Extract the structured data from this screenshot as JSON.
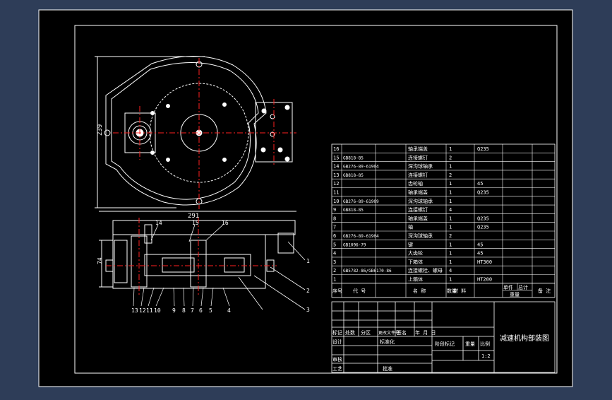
{
  "drawing": {
    "title": "减速机构部装图",
    "scale_value": "1:2",
    "dimensions": {
      "width_label": "291",
      "height_label": "239",
      "section_height_label": "74"
    },
    "balloons_right": [
      "1",
      "2",
      "3"
    ],
    "balloons_section_top": [
      "14",
      "15",
      "16"
    ],
    "balloons_section_bottom": [
      "13",
      "12",
      "11",
      "10",
      "9",
      "8",
      "7",
      "6",
      "5",
      "4"
    ]
  },
  "bom": {
    "rows": [
      {
        "no": "16",
        "code": "",
        "name": "轴承端盖",
        "qty": "1",
        "material": "Q235"
      },
      {
        "no": "15",
        "code": "GB818-85",
        "name": "连接螺钉",
        "qty": "2",
        "material": ""
      },
      {
        "no": "14",
        "code": "GB276-89-61904",
        "name": "深沟球轴承",
        "qty": "1",
        "material": ""
      },
      {
        "no": "13",
        "code": "GB818-85",
        "name": "连接螺钉",
        "qty": "2",
        "material": ""
      },
      {
        "no": "12",
        "code": "",
        "name": "齿轮轴",
        "qty": "1",
        "material": "45"
      },
      {
        "no": "11",
        "code": "",
        "name": "轴承端盖",
        "qty": "1",
        "material": "Q235"
      },
      {
        "no": "10",
        "code": "GB276-89-61909",
        "name": "深沟球轴承",
        "qty": "1",
        "material": ""
      },
      {
        "no": "9",
        "code": "GB818-85",
        "name": "连接螺钉",
        "qty": "4",
        "material": ""
      },
      {
        "no": "8",
        "code": "",
        "name": "轴承端盖",
        "qty": "1",
        "material": "Q235"
      },
      {
        "no": "7",
        "code": "",
        "name": "轴",
        "qty": "1",
        "material": "Q235"
      },
      {
        "no": "6",
        "code": "GB276-89-61904",
        "name": "深沟球轴承",
        "qty": "2",
        "material": ""
      },
      {
        "no": "5",
        "code": "GB1096-79",
        "name": "键",
        "qty": "1",
        "material": "45"
      },
      {
        "no": "4",
        "code": "",
        "name": "大齿轮",
        "qty": "1",
        "material": "45"
      },
      {
        "no": "3",
        "code": "",
        "name": "下箱体",
        "qty": "1",
        "material": "HT300"
      },
      {
        "no": "2",
        "code": "GB5782-86/GB6170-86",
        "name": "连接螺栓、螺母",
        "qty": "4",
        "material": ""
      },
      {
        "no": "1",
        "code": "",
        "name": "上箱体",
        "qty": "1",
        "material": "HT200"
      }
    ],
    "header": {
      "no": "序号",
      "code": "代 号",
      "name": "名 称",
      "qty": "数量",
      "material": "材 料",
      "unit": "单件",
      "total": "总计",
      "mass": "重量",
      "remark": "备 注"
    }
  },
  "title_block": {
    "mark": "标记",
    "count": "处数",
    "zone": "分区",
    "doc": "更改文件号",
    "sign": "签名",
    "date": "年 月 日",
    "design": "设计",
    "std": "标准化",
    "review": "审核",
    "process": "工艺",
    "approve": "批准",
    "stage": "阶段标记",
    "weight": "重量",
    "scale": "比例"
  },
  "colors": {
    "bg": "#000000",
    "frame": "#ffffff",
    "center": "#ff2020",
    "outer": "#2e3d58"
  }
}
